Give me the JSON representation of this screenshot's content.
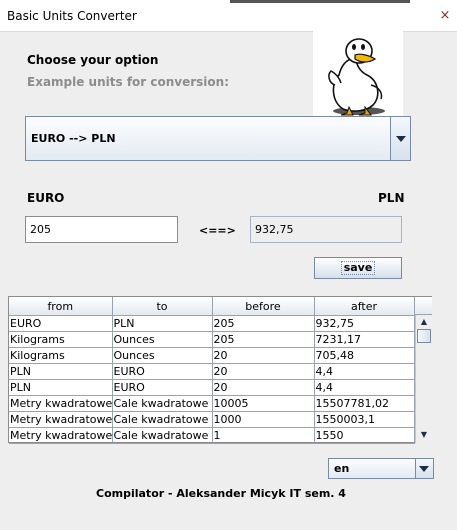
{
  "window": {
    "title": "Basic Units Converter",
    "close_glyph": "×"
  },
  "header": {
    "choose_label": "Choose your option",
    "example_label": "Example units for conversion:"
  },
  "converter": {
    "selected_option": "EURO --> PLN",
    "from_unit": "EURO",
    "to_unit": "PLN",
    "input_value": "205",
    "arrow_label": "<==>",
    "output_value": "932,75",
    "save_label": "save"
  },
  "history": {
    "columns": [
      "from",
      "to",
      "before",
      "after"
    ],
    "rows": [
      [
        "EURO",
        "PLN",
        "205",
        "932,75"
      ],
      [
        "Kilograms",
        "Ounces",
        "205",
        "7231,17"
      ],
      [
        "Kilograms",
        "Ounces",
        "20",
        "705,48"
      ],
      [
        "PLN",
        "EURO",
        "20",
        "4,4"
      ],
      [
        "PLN",
        "EURO",
        "20",
        "4,4"
      ],
      [
        "Metry kwadratowe",
        "Cale kwadratowe",
        "10005",
        "15507781,02"
      ],
      [
        "Metry kwadratowe",
        "Cale kwadratowe",
        "1000",
        "1550003,1"
      ],
      [
        "Metry kwadratowe",
        "Cale kwadratowe",
        "1",
        "1550"
      ]
    ]
  },
  "language": {
    "selected": "en"
  },
  "footer": {
    "credit": "Compilator - Aleksander Micyk IT sem. 4"
  },
  "icons": {
    "mascot": "duck-icon"
  },
  "colors": {
    "background": "#eeeeee",
    "accent_border": "#7a8aa0"
  }
}
